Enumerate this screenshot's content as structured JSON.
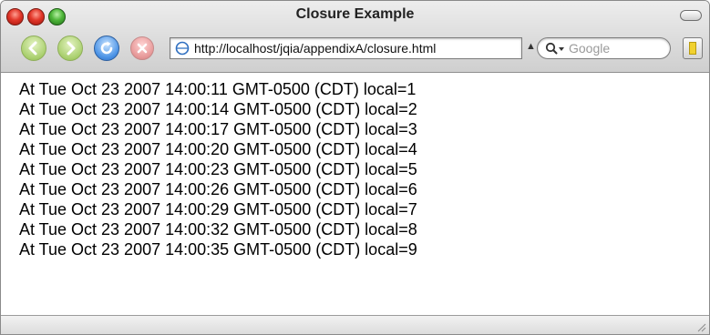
{
  "window": {
    "title": "Closure Example"
  },
  "toolbar": {
    "url": "http://localhost/jqia/appendixA/closure.html",
    "search_placeholder": "Google",
    "icons": {
      "back": "back-arrow-icon",
      "forward": "forward-arrow-icon",
      "reload": "reload-icon",
      "stop": "stop-icon",
      "url": "page-globe-icon",
      "search": "search-magnifier-icon",
      "bookmark": "bookmark-icon"
    }
  },
  "content": {
    "lines": [
      "At Tue Oct 23 2007 14:00:11 GMT-0500 (CDT) local=1",
      "At Tue Oct 23 2007 14:00:14 GMT-0500 (CDT) local=2",
      "At Tue Oct 23 2007 14:00:17 GMT-0500 (CDT) local=3",
      "At Tue Oct 23 2007 14:00:20 GMT-0500 (CDT) local=4",
      "At Tue Oct 23 2007 14:00:23 GMT-0500 (CDT) local=5",
      "At Tue Oct 23 2007 14:00:26 GMT-0500 (CDT) local=6",
      "At Tue Oct 23 2007 14:00:29 GMT-0500 (CDT) local=7",
      "At Tue Oct 23 2007 14:00:32 GMT-0500 (CDT) local=8",
      "At Tue Oct 23 2007 14:00:35 GMT-0500 (CDT) local=9"
    ]
  },
  "colors": {
    "close": "#e2372a",
    "minimize": "#e2372a",
    "zoom": "#4fb63a",
    "nav_green": "#a9cf6d",
    "reload_blue": "#4d94e6",
    "stop_red": "#e89b9b"
  }
}
